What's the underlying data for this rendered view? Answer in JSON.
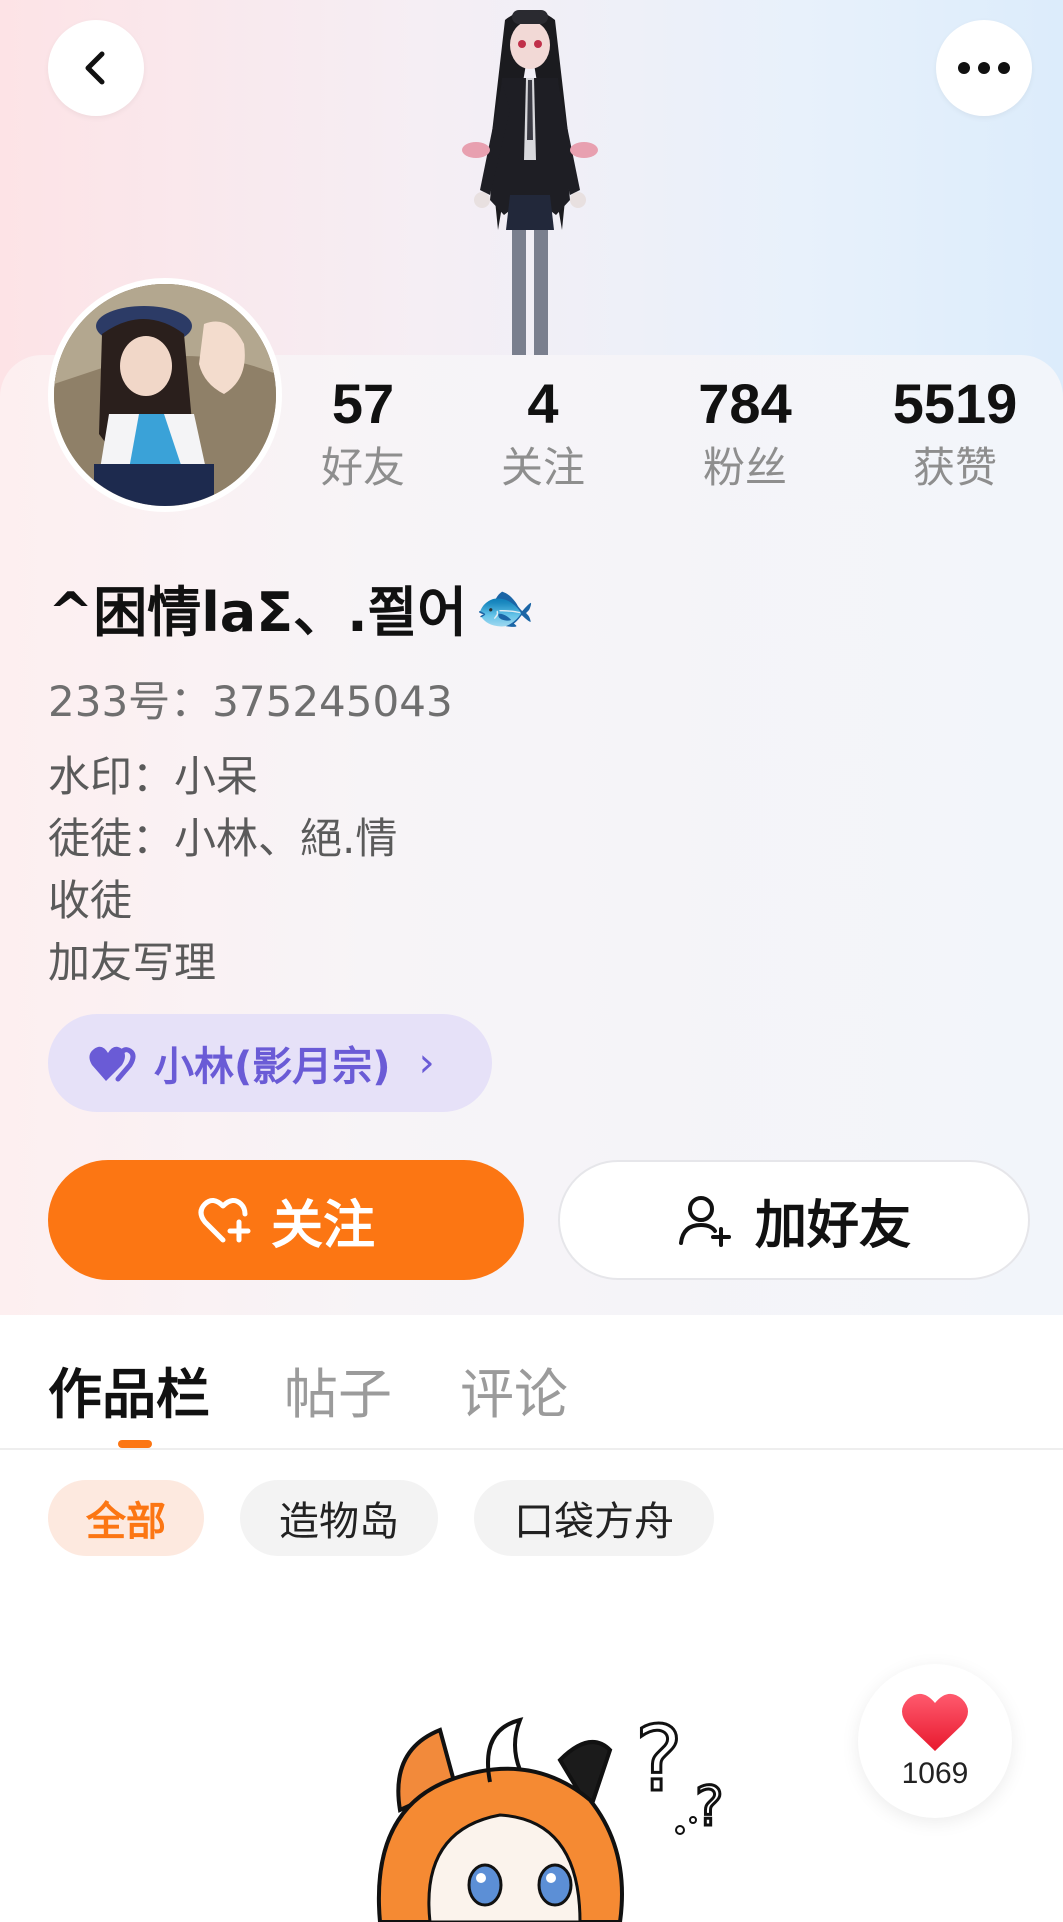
{
  "header": {
    "back_icon": "chevron-left-icon",
    "more_icon": "more-horizontal-icon"
  },
  "stats": [
    {
      "value": "57",
      "label": "好友"
    },
    {
      "value": "4",
      "label": "关注"
    },
    {
      "value": "784",
      "label": "粉丝"
    },
    {
      "value": "5519",
      "label": "获赞"
    }
  ],
  "profile": {
    "nickname": "^困情laΣ、.쬘어",
    "nickname_emoji": "🐟",
    "uid": "233号：375245043",
    "bio": [
      "水印：小呆",
      "徒徒：小林、絕.情",
      "收徒",
      "加友写理"
    ]
  },
  "guild": {
    "name": "小林(影月宗)",
    "chevron": "›",
    "icon": "heart-pair-icon"
  },
  "actions": {
    "follow_label": "关注",
    "add_friend_label": "加好友"
  },
  "tabs": [
    {
      "label": "作品栏",
      "active": true
    },
    {
      "label": "帖子",
      "active": false
    },
    {
      "label": "评论",
      "active": false
    }
  ],
  "filters": [
    {
      "label": "全部",
      "active": true
    },
    {
      "label": "造物岛",
      "active": false
    },
    {
      "label": "口袋方舟",
      "active": false
    }
  ],
  "like_float": {
    "count": "1069",
    "icon": "heart-icon"
  },
  "colors": {
    "accent": "#fc7613",
    "guild": "#6a5bd6"
  }
}
